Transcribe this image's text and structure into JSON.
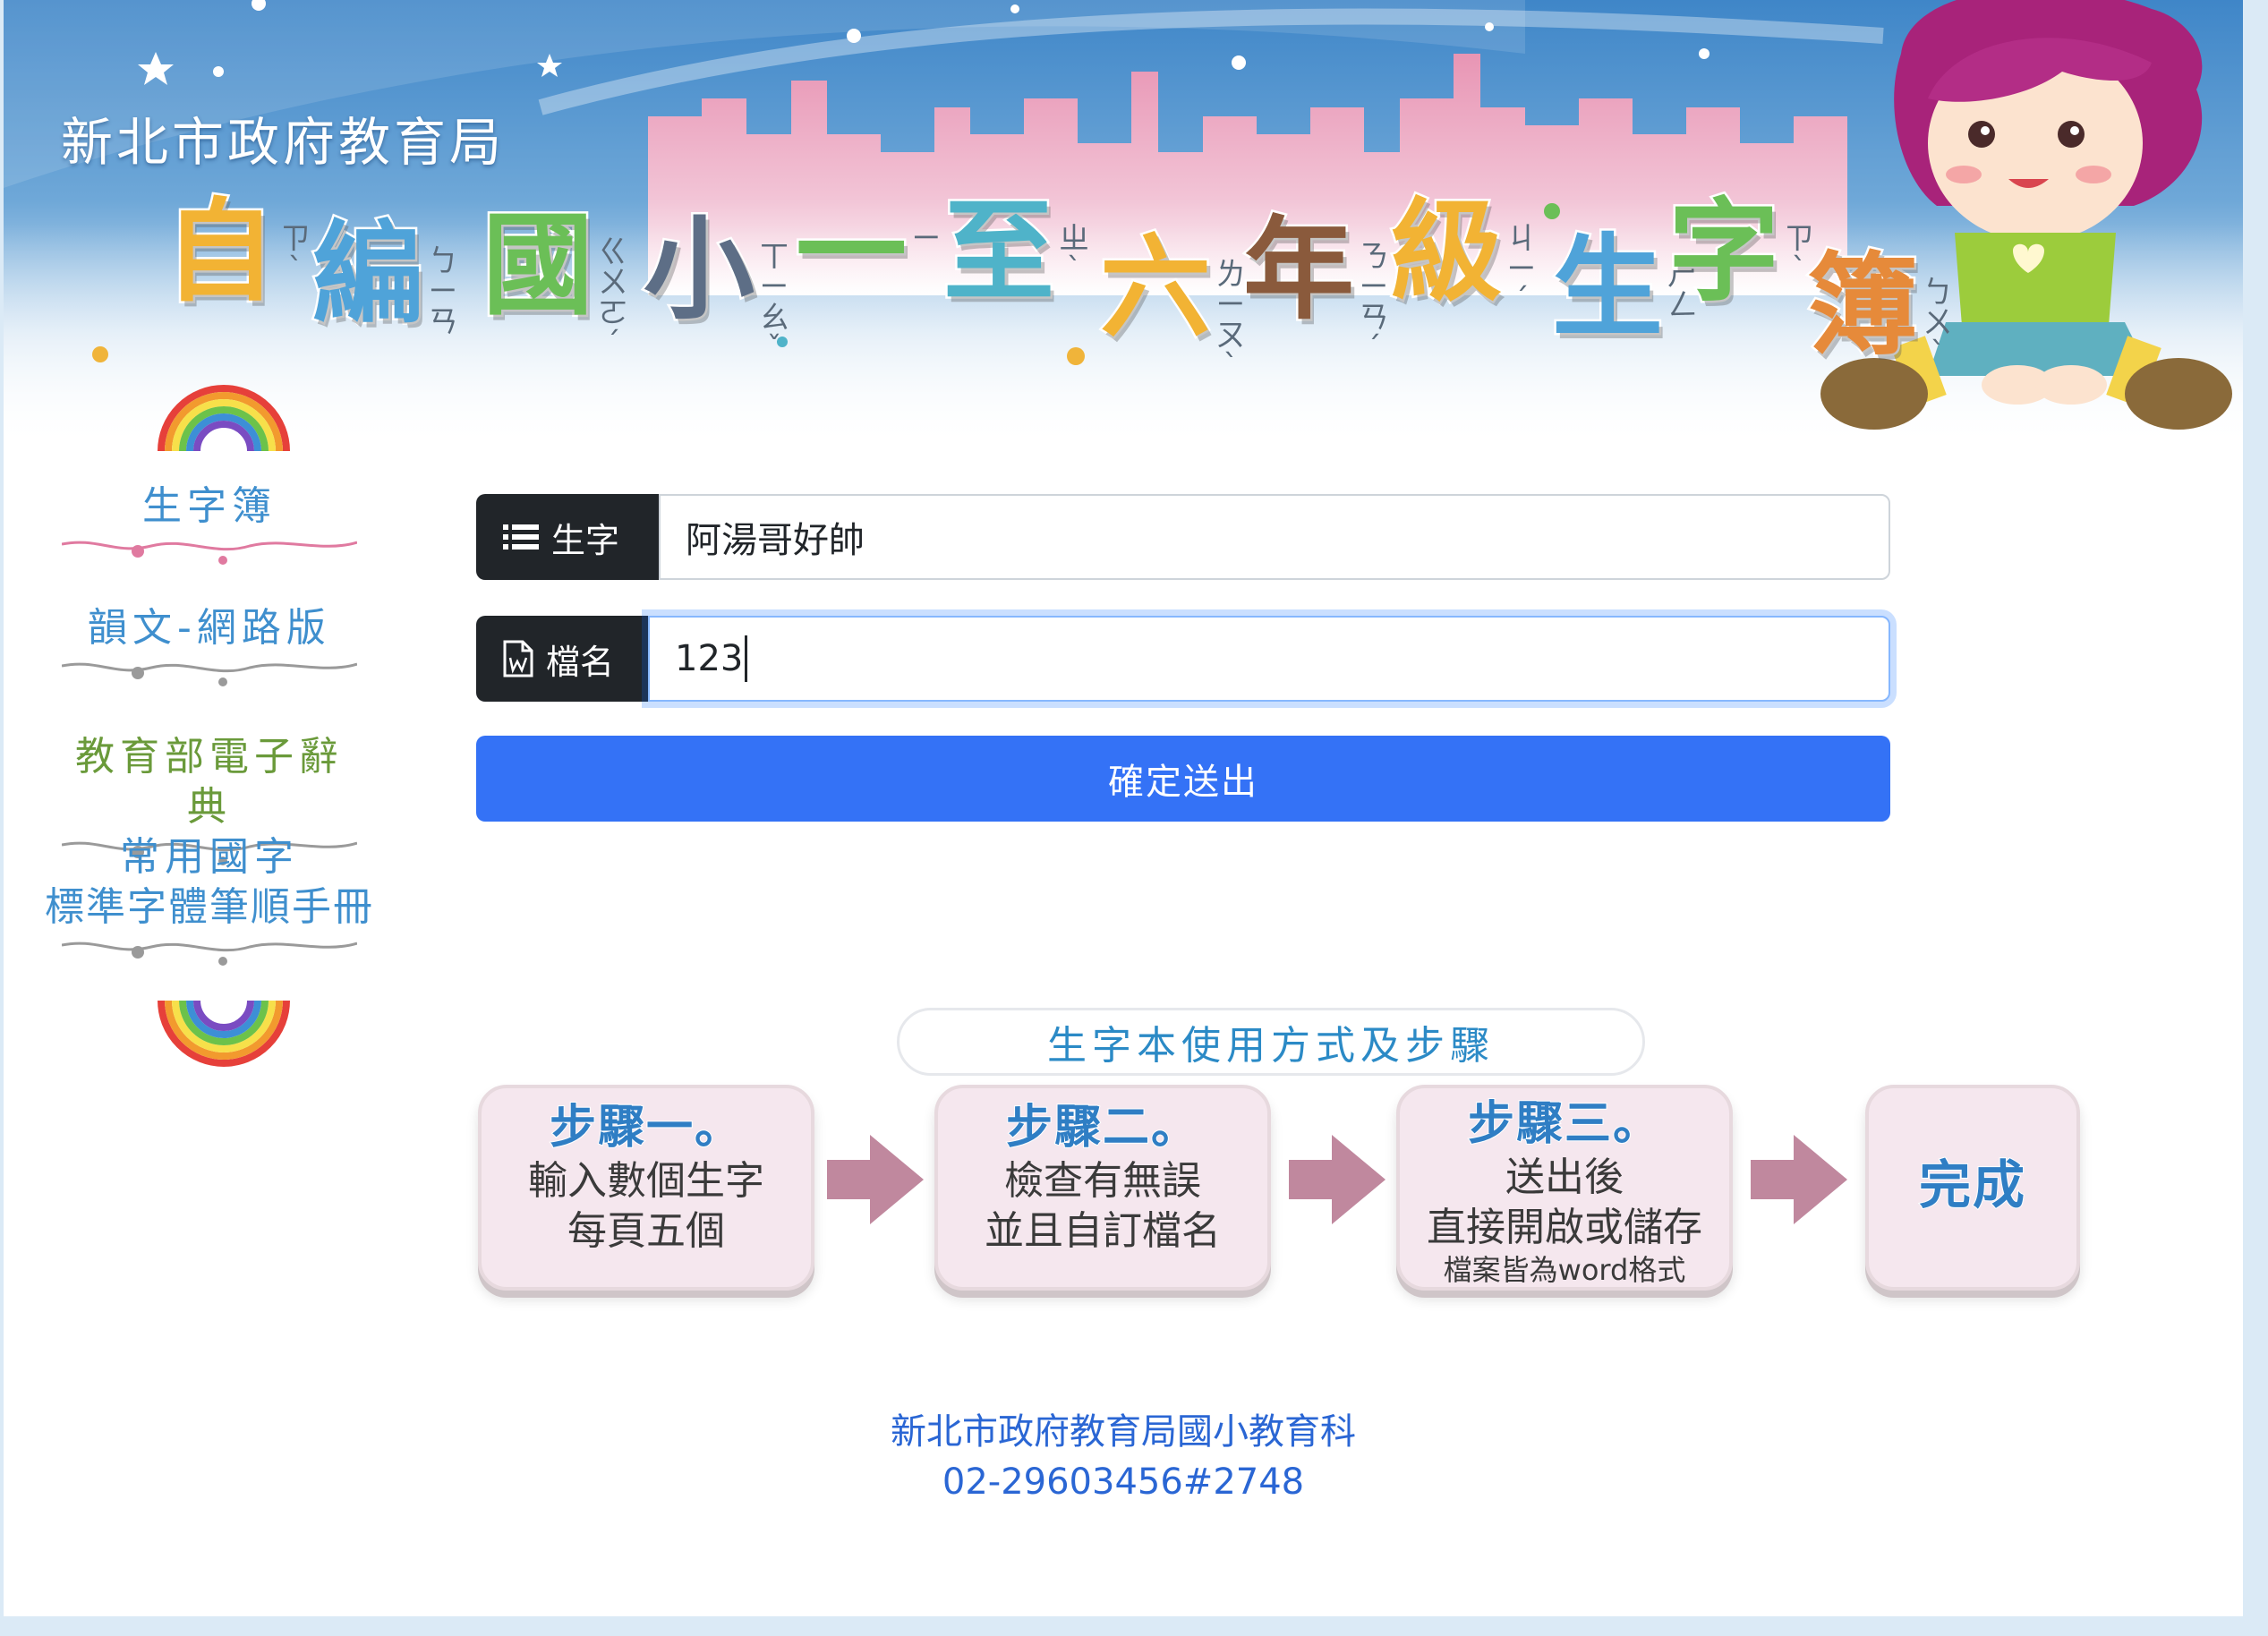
{
  "banner": {
    "agency": "新北市政府教育局",
    "title_chars": [
      {
        "char": "自",
        "zhuyin": "ㄗˋ",
        "color": "#f2b334"
      },
      {
        "char": "編",
        "zhuyin": "ㄅㄧㄢ",
        "color": "#4fa3d9"
      },
      {
        "char": "國",
        "zhuyin": "ㄍㄨㄛˊ",
        "color": "#6bbf57"
      },
      {
        "char": "小",
        "zhuyin": "ㄒㄧㄠˇ",
        "color": "#5d6e86"
      },
      {
        "char": "一",
        "zhuyin": "ㄧ",
        "color": "#6bbf57"
      },
      {
        "char": "至",
        "zhuyin": "ㄓˋ",
        "color": "#4fb3c9"
      },
      {
        "char": "六",
        "zhuyin": "ㄌㄧㄡˋ",
        "color": "#f2b334"
      },
      {
        "char": "年",
        "zhuyin": "ㄋㄧㄢˊ",
        "color": "#8a5a3c"
      },
      {
        "char": "級",
        "zhuyin": "ㄐㄧˊ",
        "color": "#f2b334"
      },
      {
        "char": "生",
        "zhuyin": "ㄕㄥ",
        "color": "#4fa3d9"
      },
      {
        "char": "字",
        "zhuyin": "ㄗˋ",
        "color": "#6bbf57"
      },
      {
        "char": "簿",
        "zhuyin": "ㄅㄨˋ",
        "color": "#e68a3a"
      }
    ]
  },
  "sidebar": {
    "items": [
      {
        "label": "生字簿",
        "color": "#3f8fce"
      },
      {
        "label": "韻文-網路版",
        "color": "#3f8fce"
      },
      {
        "label": "教育部電子辭典",
        "color": "#6a9a3a"
      },
      {
        "label_line1": "常用國字",
        "label_line2": "標準字體筆順手冊",
        "color": "#3f8fce"
      }
    ]
  },
  "form": {
    "word_label": "生字",
    "word_value": "阿湯哥好帥",
    "file_label": "檔名",
    "file_value": "123",
    "submit_label": "確定送出"
  },
  "steps": {
    "title": "生字本使用方式及步驟",
    "items": [
      {
        "head": "步驟一。",
        "line1": "輸入數個生字",
        "line2": "每頁五個"
      },
      {
        "head": "步驟二。",
        "line1": "檢查有無誤",
        "line2": "並且自訂檔名"
      },
      {
        "head": "步驟三。",
        "line1": "送出後",
        "line2": "直接開啟或儲存",
        "note": "檔案皆為word格式"
      },
      {
        "head": "完成"
      }
    ]
  },
  "footer": {
    "line1": "新北市政府教育局國小教育科",
    "line2": "02-29603456#2748"
  }
}
